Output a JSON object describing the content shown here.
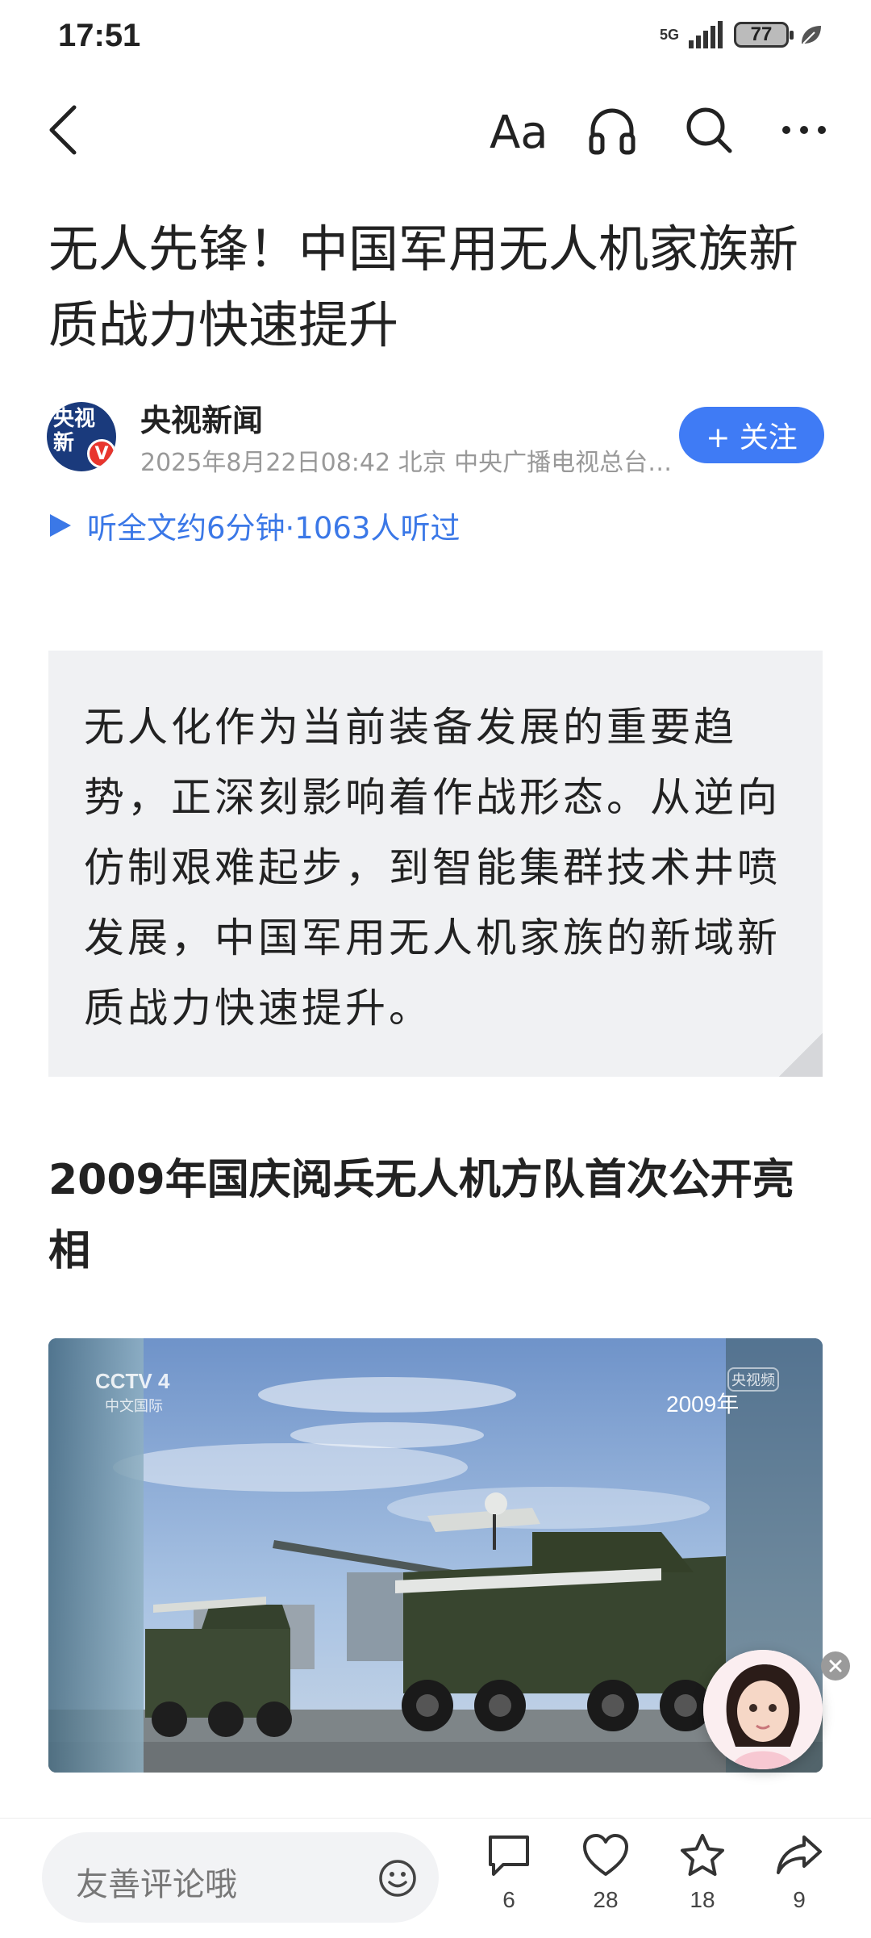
{
  "status": {
    "time": "17:51",
    "network": "5G",
    "battery": "77"
  },
  "article": {
    "title": "无人先锋！中国军用无人机家族新质战力快速提升",
    "author": {
      "name": "央视新闻",
      "avatar_text": "央视新",
      "verified_mark": "V",
      "meta": "2025年8月22日08:42 北京 中央广播电视总台…"
    },
    "follow_label": "+ 关注",
    "listen_text": "听全文约6分钟·1063人听过",
    "summary": "无人化作为当前装备发展的重要趋势，正深刻影响着作战形态。从逆向仿制艰难起步，到智能集群技术井喷发展，中国军用无人机家族的新域新质战力快速提升。",
    "section_heading": "2009年国庆阅兵无人机方队首次公开亮相",
    "video": {
      "channel_logo": "CCTV 4",
      "channel_sub": "中文国际",
      "year_tag": "2009年",
      "badge": "央视频"
    }
  },
  "bottom": {
    "comment_placeholder": "友善评论哦",
    "comments": "6",
    "likes": "28",
    "favorites": "18",
    "shares": "9"
  }
}
